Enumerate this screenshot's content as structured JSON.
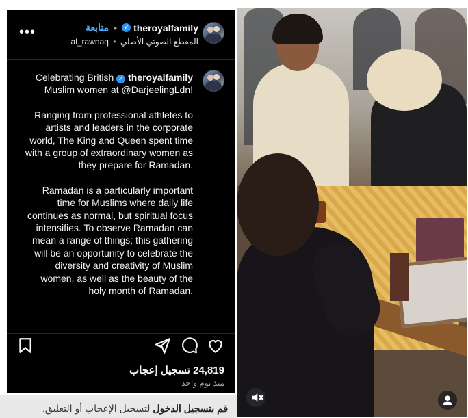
{
  "header": {
    "username": "theroyalfamily",
    "follow_label": "متابعة",
    "separator": "•",
    "audio_label": "المقطع الصوتي الأصلي",
    "audio_user": "al_rawnaq",
    "more_icon": "more-horizontal-icon"
  },
  "caption": {
    "lead_text": "Celebrating British",
    "author": "theroyalfamily",
    "line_after": "Muslim women at @DarjeelingLdn!",
    "paragraph_1": "Ranging from professional athletes to artists and leaders in the corporate world, The King and Queen spent time with a group of extraordinary women as they prepare for Ramadan.",
    "paragraph_2": "Ramadan is a particularly important time for Muslims where daily life continues as normal, but spiritual focus intensifies. To observe Ramadan can mean a range of things; this gathering will be an opportunity to celebrate the diversity and creativity of Muslim women, as well as the beauty of the holy month of Ramadan."
  },
  "actions": {
    "like_icon": "heart-icon",
    "comment_icon": "comment-icon",
    "share_icon": "send-icon",
    "save_icon": "bookmark-icon"
  },
  "stats": {
    "likes": "24,819 تسجيل إعجاب",
    "time_ago": "منذ يوم واحد"
  },
  "footer": {
    "login_link": "قم بتسجيل الدخول",
    "login_rest": " لتسجيل الإعجاب أو التعليق."
  },
  "media": {
    "mute_icon": "muted-speaker-icon",
    "tags_icon": "user-tag-icon"
  },
  "colors": {
    "accent_blue": "#4aa8f7",
    "verified_blue": "#2d95f0",
    "panel_bg": "#000000"
  }
}
